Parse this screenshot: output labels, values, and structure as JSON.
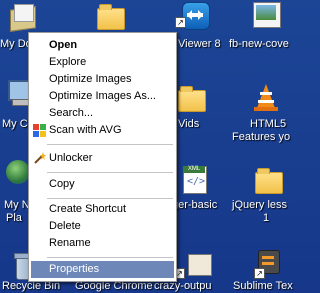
{
  "desktop": {
    "labels": {
      "my_documents": "My Doc",
      "teamviewer": "Viewer 8",
      "fb_new_cover": "fb-new-cove",
      "my_computer": "My Co",
      "vids": "Vids",
      "html5_line1": "HTML5",
      "html5_line2": "Features yo",
      "my_network_line1": "My N",
      "my_network_line2": "Pla",
      "ger_basic": "ger-basic",
      "jquery_line1": "jQuery less",
      "jquery_line2": "1",
      "recycle_bin": "Recycle Bin",
      "google_chrome": "Google Chrome",
      "crazy_output": "crazy-outpu",
      "sublime_text": "Sublime Tex"
    }
  },
  "context_menu": {
    "items": [
      {
        "label": "Open"
      },
      {
        "label": "Explore"
      },
      {
        "label": "Optimize Images"
      },
      {
        "label": "Optimize Images As..."
      },
      {
        "label": "Search..."
      },
      {
        "label": "Scan with AVG"
      },
      {
        "label": "Unlocker"
      },
      {
        "label": "Copy"
      },
      {
        "label": "Create Shortcut"
      },
      {
        "label": "Delete"
      },
      {
        "label": "Rename"
      },
      {
        "label": "Properties"
      }
    ],
    "selected": "Properties"
  },
  "colors": {
    "desktop_background": "#1a3f8f",
    "menu_highlight": "#6d87b8"
  }
}
